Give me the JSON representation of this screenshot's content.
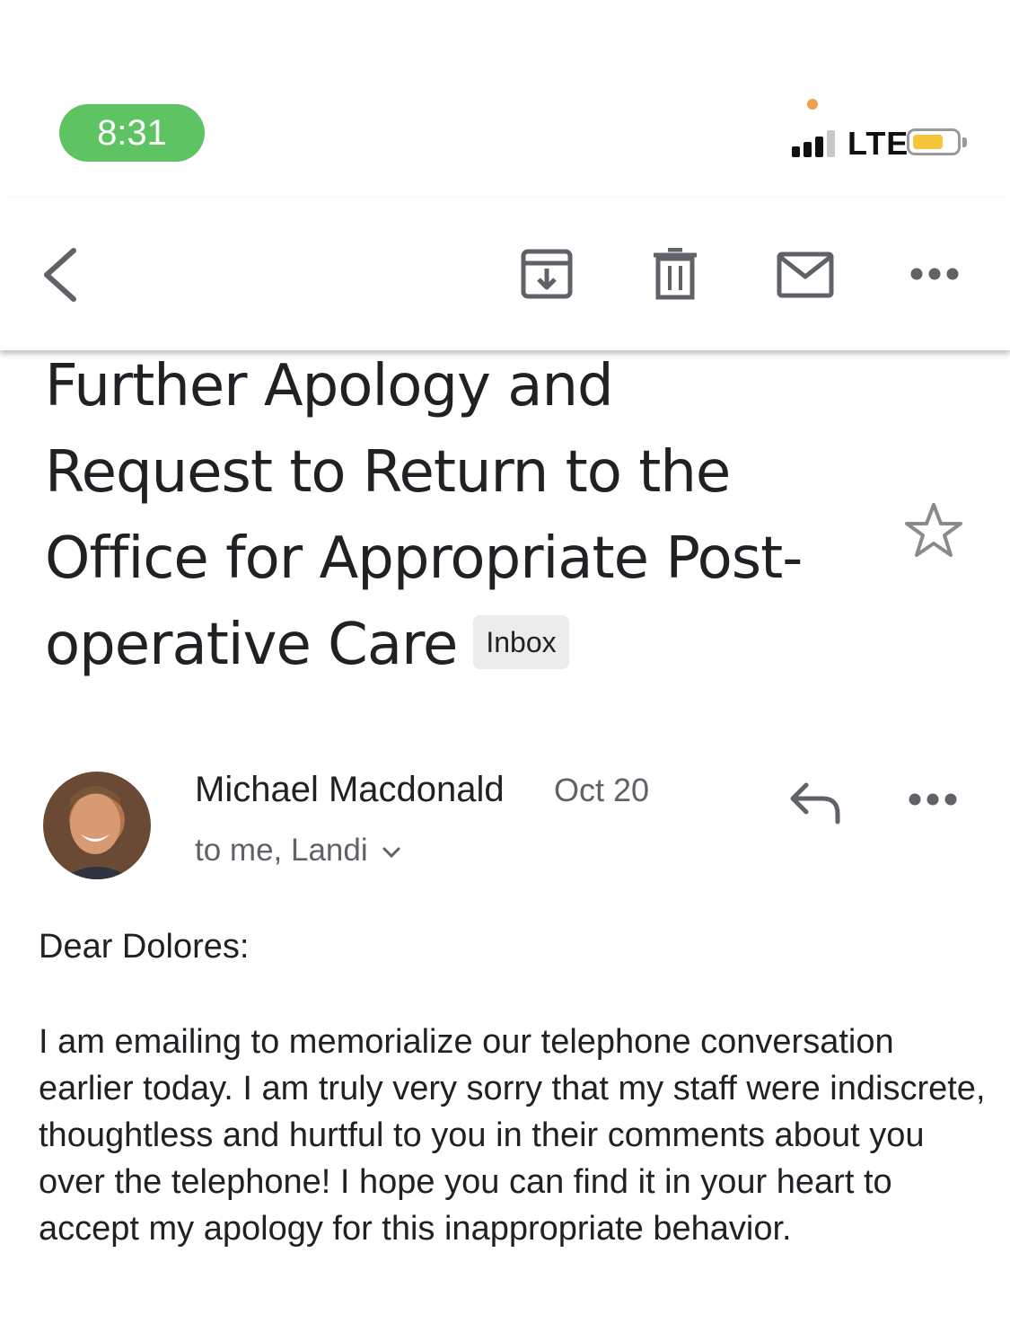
{
  "status_bar": {
    "time": "8:31",
    "network": "LTE",
    "colors": {
      "time_pill": "#5ec463",
      "battery_fill": "#f5c53b",
      "privacy_dot": "#f0a04b"
    },
    "icons": [
      "signal-icon",
      "battery-icon"
    ]
  },
  "toolbar": {
    "icons": [
      "back-icon",
      "archive-icon",
      "delete-icon",
      "mark-unread-icon",
      "more-icon"
    ]
  },
  "email": {
    "subject": "Further Apology and Request to Return to the Office for Appropriate Post-operative Care",
    "label": "Inbox",
    "sender_name": "Michael Macdonald",
    "date": "Oct 20",
    "recipients": "to me, Landi",
    "greeting": "Dear Dolores:",
    "body": "I am emailing to memorialize our telephone conversation earlier today. I am truly very sorry that my staff were indiscrete, thoughtless and hurtful to you in their comments about you over the telephone! I hope you can find it in your heart to accept my apology for this inappropriate behavior."
  }
}
